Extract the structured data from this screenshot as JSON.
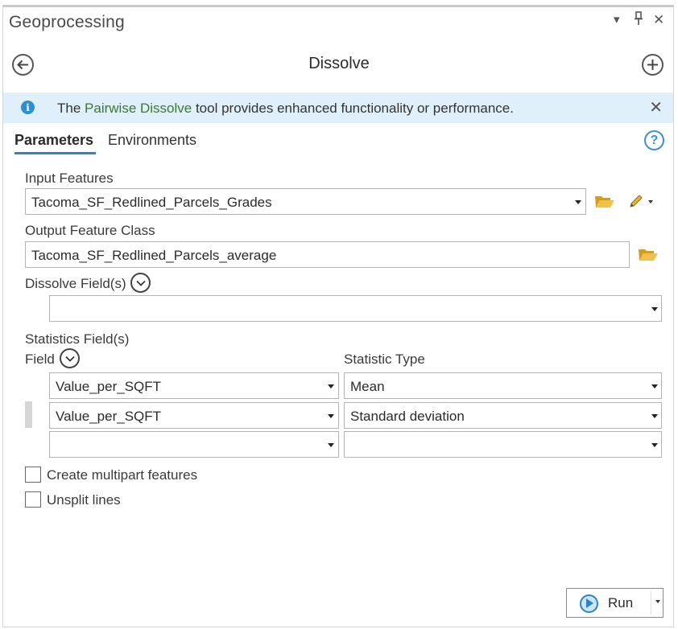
{
  "pane": {
    "title": "Geoprocessing",
    "controls": {
      "menu": "▾",
      "pin": "⩒",
      "close": "✕"
    }
  },
  "tool": {
    "title": "Dissolve"
  },
  "banner": {
    "prefix": "The ",
    "link": "Pairwise Dissolve",
    "suffix": " tool provides enhanced functionality or performance."
  },
  "tabs": {
    "parameters": "Parameters",
    "environments": "Environments"
  },
  "help_glyph": "?",
  "params": {
    "input_features": {
      "label": "Input Features",
      "value": "Tacoma_SF_Redlined_Parcels_Grades"
    },
    "output_feature_class": {
      "label": "Output Feature Class",
      "value": "Tacoma_SF_Redlined_Parcels_average"
    },
    "dissolve_fields": {
      "label": "Dissolve Field(s)",
      "value": ""
    },
    "statistics": {
      "label": "Statistics Field(s)",
      "field_header": "Field",
      "type_header": "Statistic Type",
      "rows": [
        {
          "field": "Value_per_SQFT",
          "type": "Mean"
        },
        {
          "field": "Value_per_SQFT",
          "type": "Standard deviation"
        },
        {
          "field": "",
          "type": ""
        }
      ]
    },
    "create_multipart": {
      "label": "Create multipart features",
      "checked": false
    },
    "unsplit_lines": {
      "label": "Unsplit lines",
      "checked": false
    }
  },
  "run": {
    "label": "Run"
  },
  "colors": {
    "accent": "#2a85c7",
    "banner_bg": "#dff0fa",
    "link": "#3a7a32",
    "folder": "#e0b23a"
  }
}
